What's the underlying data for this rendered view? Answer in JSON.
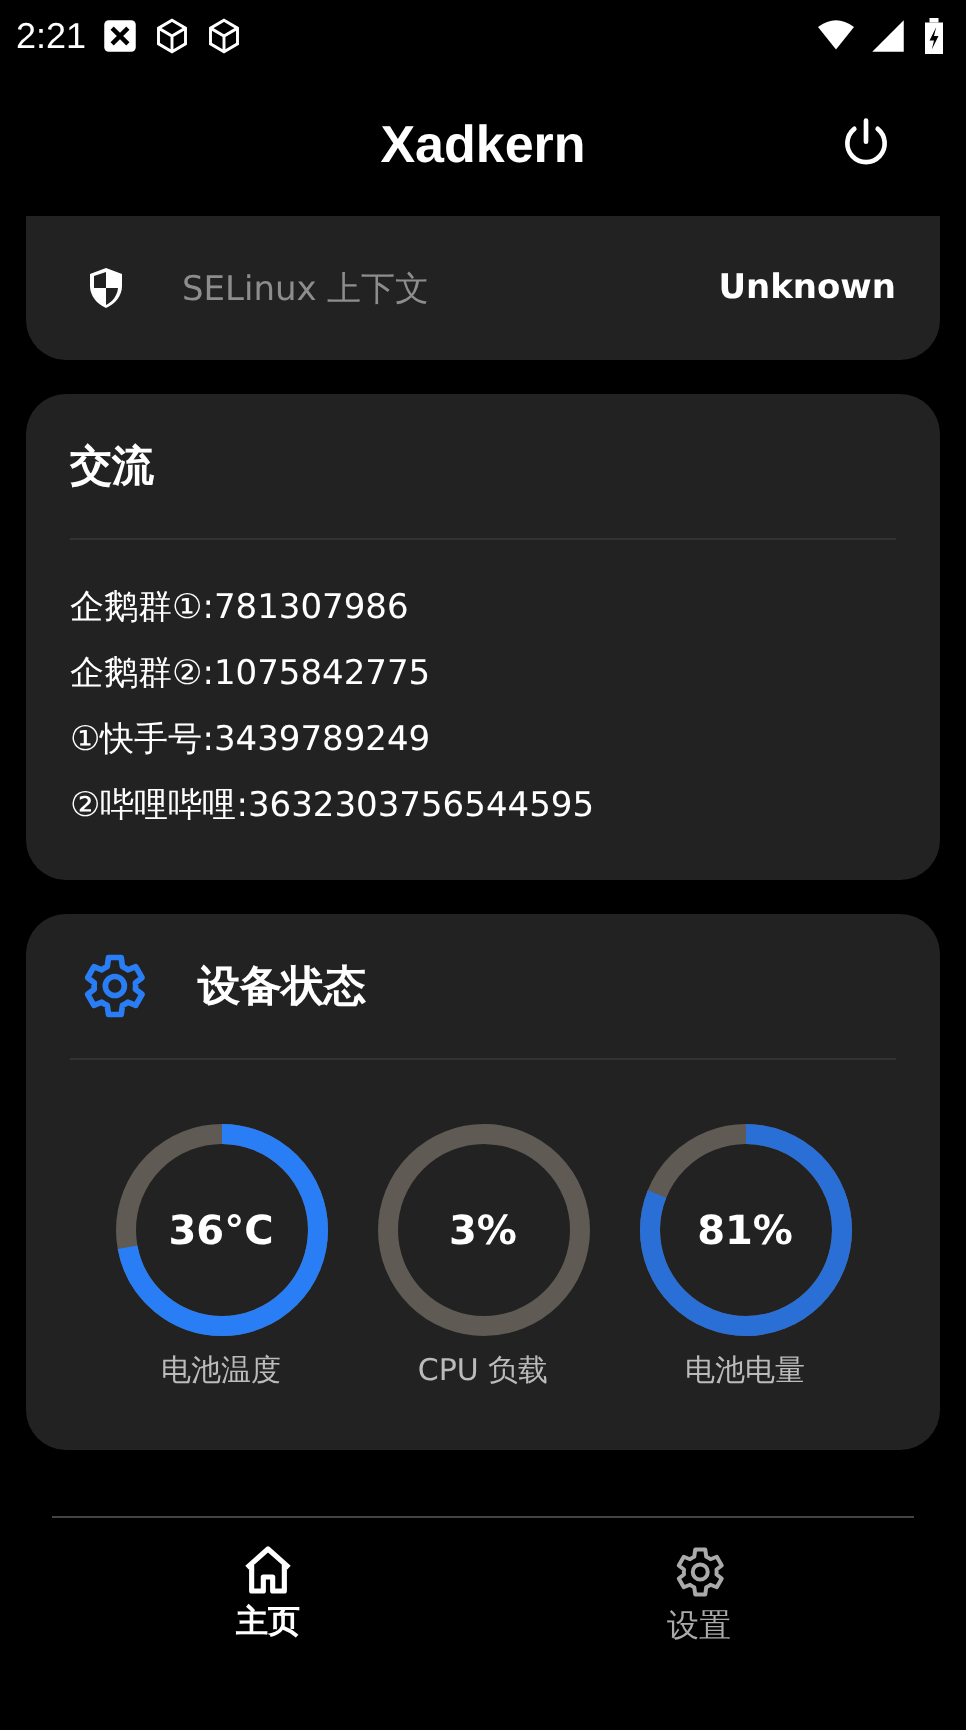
{
  "status_bar": {
    "time": "2:21"
  },
  "app_bar": {
    "title": "Xadkern"
  },
  "selinux": {
    "label": "SELinux 上下文",
    "value": "Unknown"
  },
  "contact": {
    "title": "交流",
    "lines": [
      "企鹅群①:781307986",
      "企鹅群②:1075842775",
      "①快手号:3439789249",
      "②哔哩哔哩:3632303756544595"
    ]
  },
  "device": {
    "title": "设备状态",
    "gauges": [
      {
        "reading": "36°C",
        "label": "电池温度",
        "level": 0.72,
        "color": "#2a7ef5"
      },
      {
        "reading": "3%",
        "label": "CPU 负载",
        "level": 0.03,
        "color": "#5f5a53"
      },
      {
        "reading": "81%",
        "label": "电池电量",
        "level": 0.81,
        "color": "#2a6fd6"
      }
    ]
  },
  "nav": [
    {
      "label": "主页",
      "kind": "home",
      "selected": true
    },
    {
      "label": "设置",
      "kind": "settings",
      "selected": false
    }
  ]
}
